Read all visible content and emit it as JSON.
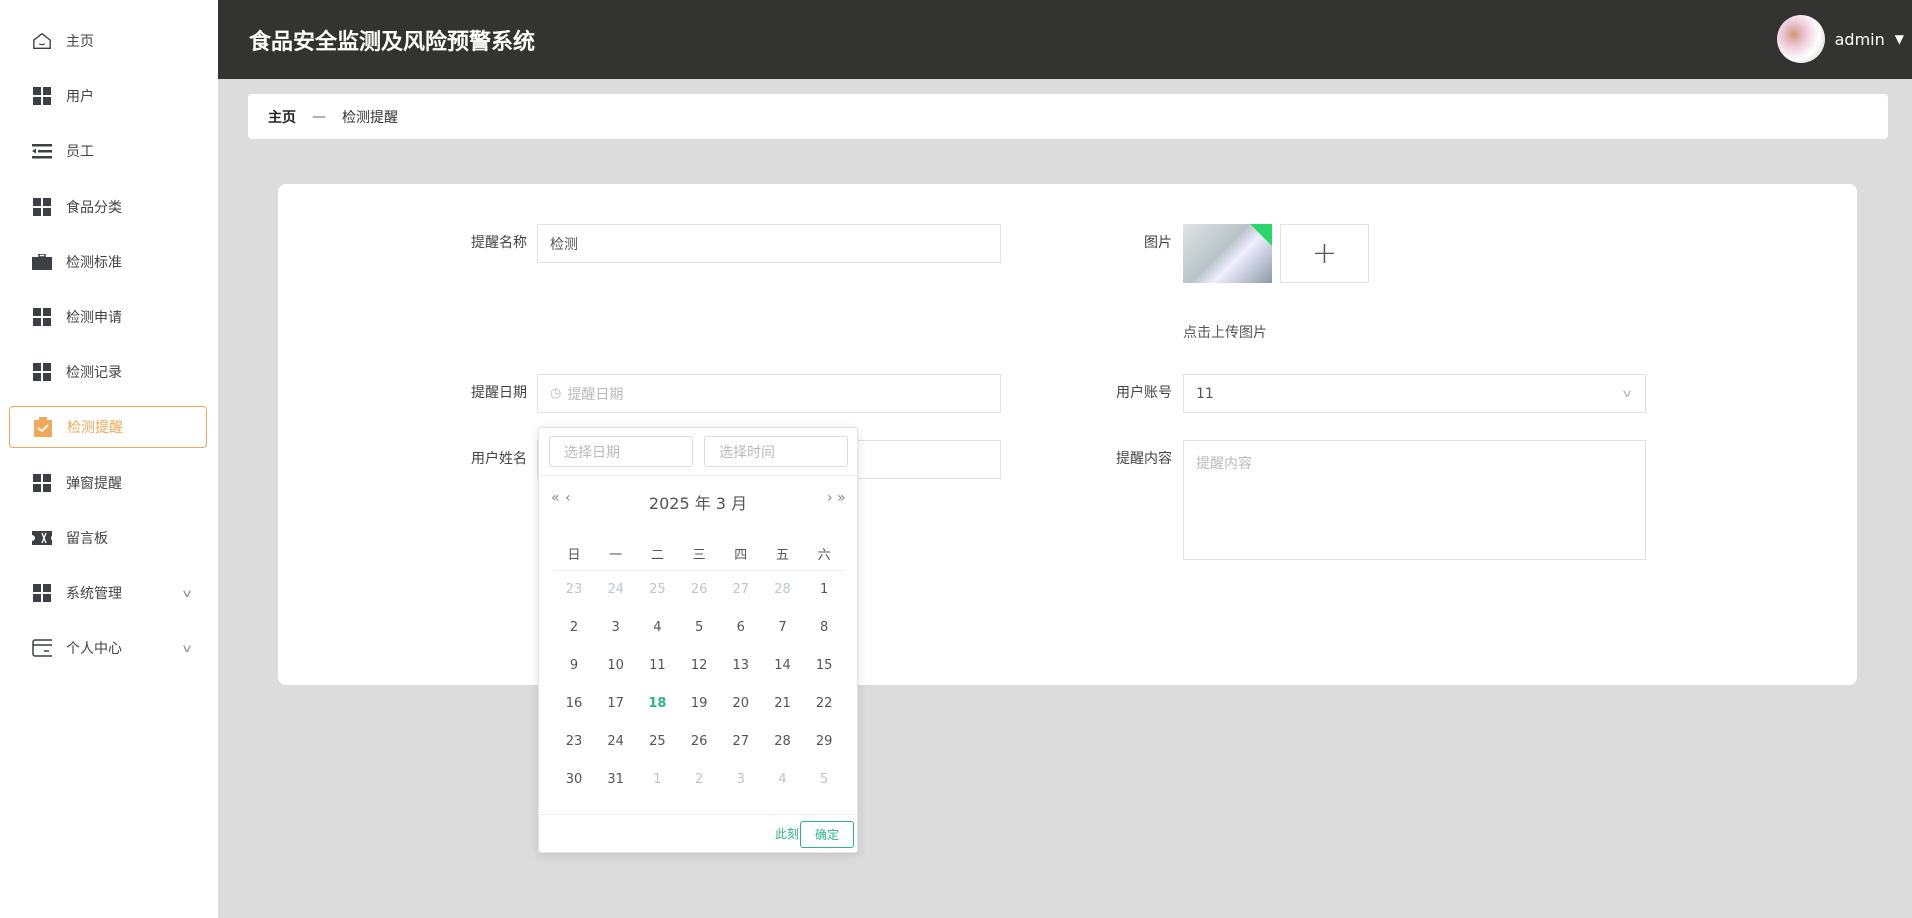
{
  "sidebar": {
    "items": [
      {
        "label": "主页",
        "icon": "home-icon"
      },
      {
        "label": "用户",
        "icon": "grid-icon"
      },
      {
        "label": "员工",
        "icon": "list-indent-icon"
      },
      {
        "label": "食品分类",
        "icon": "grid-icon"
      },
      {
        "label": "检测标准",
        "icon": "briefcase-icon"
      },
      {
        "label": "检测申请",
        "icon": "grid-icon"
      },
      {
        "label": "检测记录",
        "icon": "grid-icon"
      },
      {
        "label": "检测提醒",
        "icon": "clipboard-check-icon",
        "active": true
      },
      {
        "label": "弹窗提醒",
        "icon": "grid-icon"
      },
      {
        "label": "留言板",
        "icon": "ticket-icon"
      },
      {
        "label": "系统管理",
        "icon": "grid-icon",
        "expandable": true
      },
      {
        "label": "个人中心",
        "icon": "wallet-icon",
        "expandable": true
      }
    ]
  },
  "header": {
    "title": "食品安全监测及风险预警系统",
    "username": "admin"
  },
  "breadcrumb": {
    "home": "主页",
    "separator": "—",
    "current": "检测提醒"
  },
  "form": {
    "name_label": "提醒名称",
    "name_value": "检测",
    "date_label": "提醒日期",
    "date_placeholder": "提醒日期",
    "username_label": "用户姓名",
    "image_label": "图片",
    "upload_hint": "点击上传图片",
    "account_label": "用户账号",
    "account_value": "11",
    "content_label": "提醒内容",
    "content_placeholder": "提醒内容"
  },
  "datepicker": {
    "date_placeholder": "选择日期",
    "time_placeholder": "选择时间",
    "title": "2025 年  3 月",
    "weekdays": [
      "日",
      "一",
      "二",
      "三",
      "四",
      "五",
      "六"
    ],
    "days": [
      [
        "23",
        "24",
        "25",
        "26",
        "27",
        "28",
        "1"
      ],
      [
        "2",
        "3",
        "4",
        "5",
        "6",
        "7",
        "8"
      ],
      [
        "9",
        "10",
        "11",
        "12",
        "13",
        "14",
        "15"
      ],
      [
        "16",
        "17",
        "18",
        "19",
        "20",
        "21",
        "22"
      ],
      [
        "23",
        "24",
        "25",
        "26",
        "27",
        "28",
        "29"
      ],
      [
        "30",
        "31",
        "1",
        "2",
        "3",
        "4",
        "5"
      ]
    ],
    "today": "18",
    "now_label": "此刻",
    "confirm_label": "确定"
  },
  "colors": {
    "accent": "#f0a95b",
    "header": "#333431",
    "picker": "#2fb58a"
  }
}
